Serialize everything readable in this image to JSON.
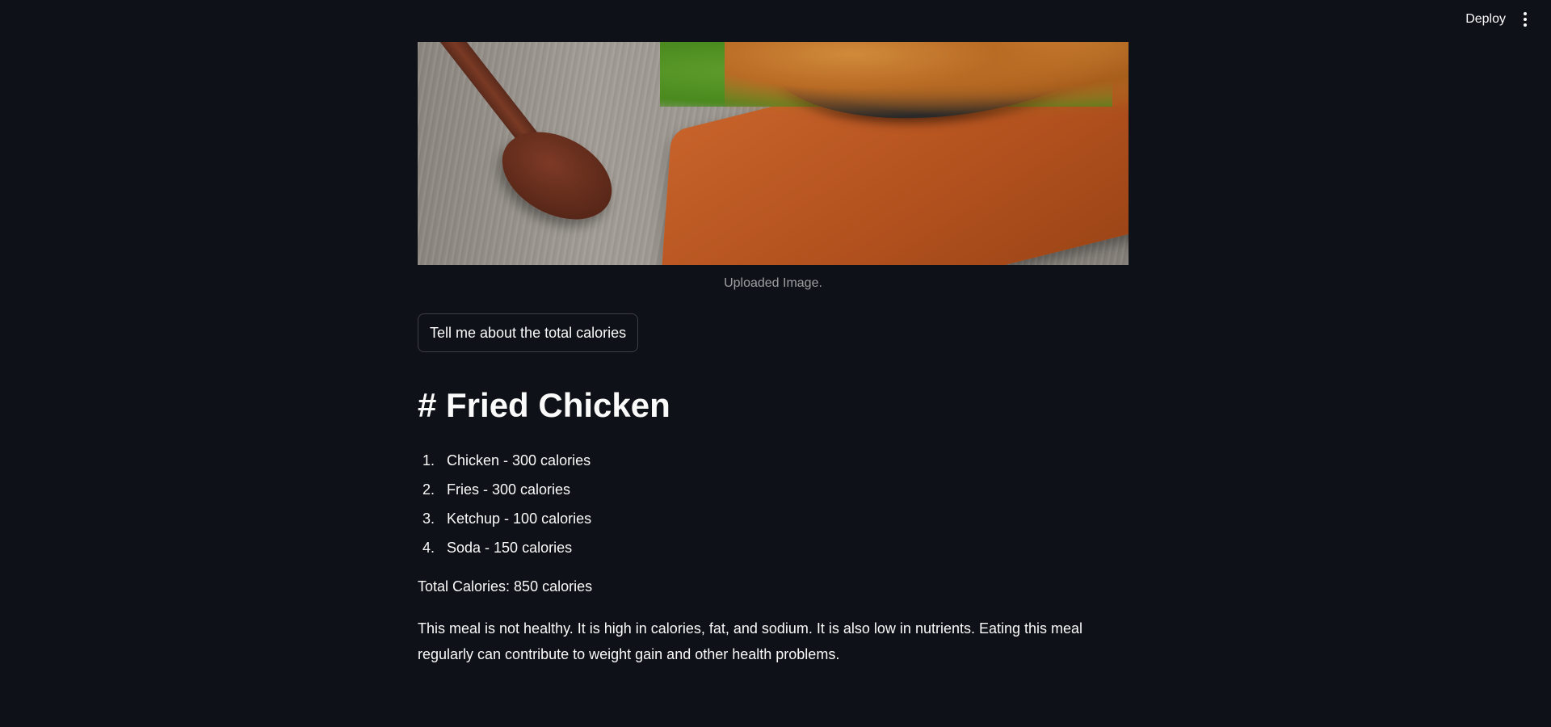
{
  "header": {
    "deploy_label": "Deploy",
    "menu_icon": "more-vertical-icon"
  },
  "image": {
    "caption": "Uploaded Image."
  },
  "action": {
    "button_label": "Tell me about the total calories"
  },
  "result": {
    "title": "# Fried Chicken",
    "items": [
      {
        "num": "1.",
        "text": "Chicken - 300 calories"
      },
      {
        "num": "2.",
        "text": "Fries - 300 calories"
      },
      {
        "num": "3.",
        "text": "Ketchup - 100 calories"
      },
      {
        "num": "4.",
        "text": "Soda - 150 calories"
      }
    ],
    "total": "Total Calories: 850 calories",
    "summary": "This meal is not healthy. It is high in calories, fat, and sodium. It is also low in nutrients. Eating this meal regularly can contribute to weight gain and other health problems."
  },
  "colors": {
    "background": "#0e1117",
    "text": "#fafafa",
    "caption": "#9a9a9e"
  }
}
